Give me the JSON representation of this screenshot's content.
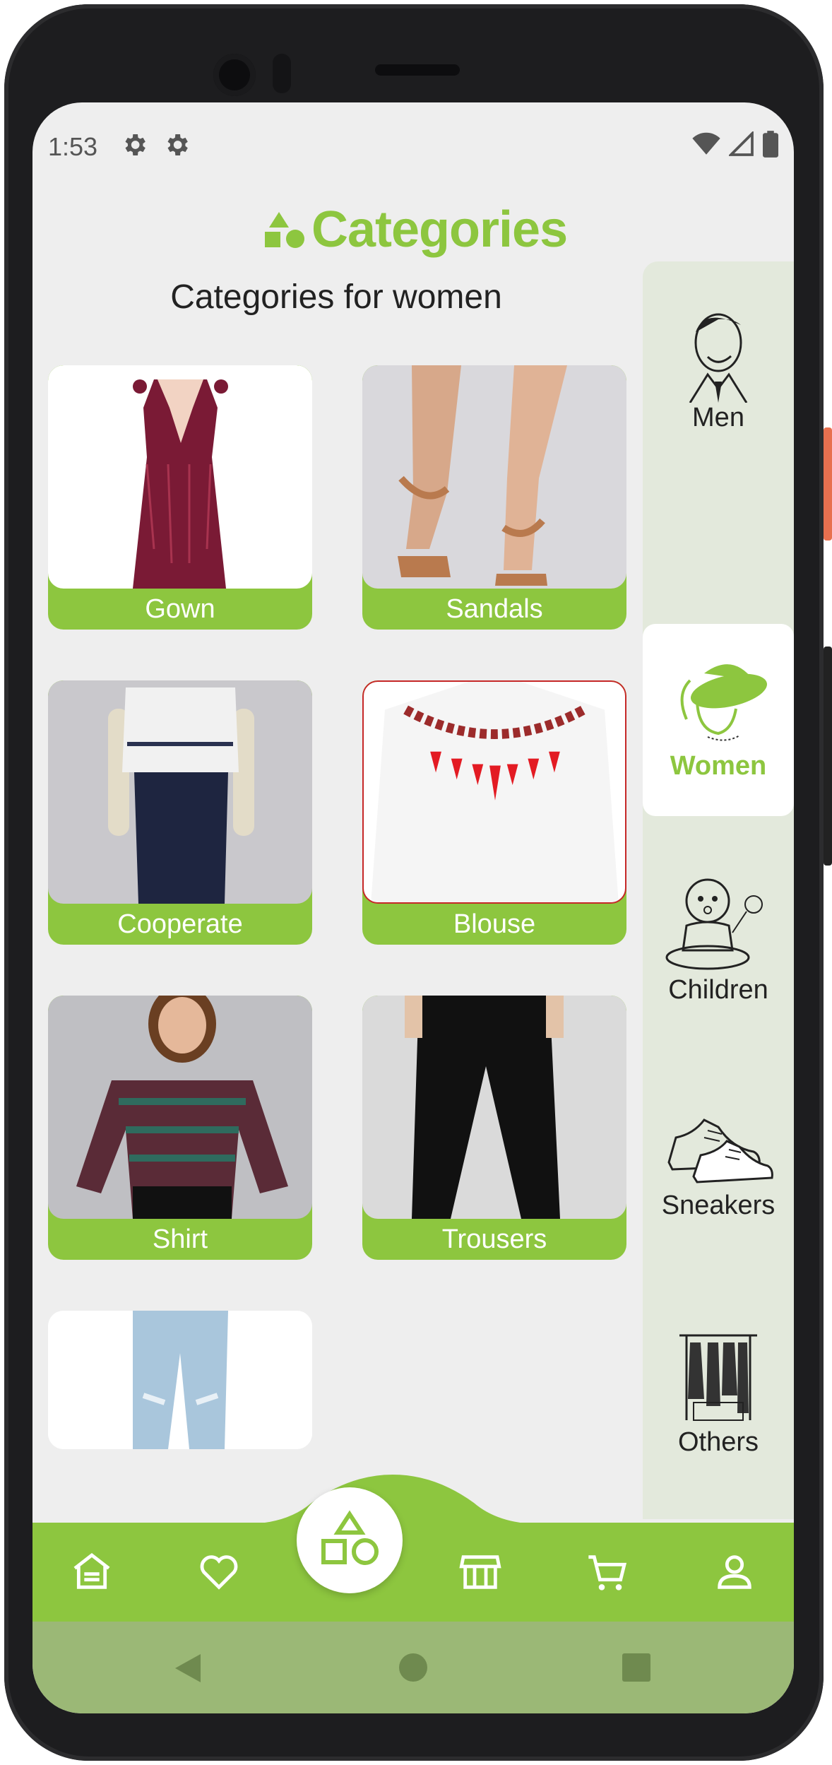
{
  "status_bar": {
    "time": "1:53",
    "icons": [
      "settings-icon",
      "settings-icon",
      "wifi-icon",
      "signal-icon",
      "battery-icon"
    ]
  },
  "header": {
    "title": "Categories",
    "subtitle": "Categories for women"
  },
  "categories": [
    {
      "label": "Gown"
    },
    {
      "label": "Sandals"
    },
    {
      "label": "Cooperate"
    },
    {
      "label": "Blouse"
    },
    {
      "label": "Shirt"
    },
    {
      "label": "Trousers"
    },
    {
      "label": ""
    }
  ],
  "sidebar": {
    "items": [
      {
        "label": "Men",
        "icon": "man-sketch-icon"
      },
      {
        "label": "Women",
        "icon": "woman-hat-icon",
        "active": true
      },
      {
        "label": "Children",
        "icon": "baby-sketch-icon"
      },
      {
        "label": "Sneakers",
        "icon": "sneakers-sketch-icon"
      },
      {
        "label": "Others",
        "icon": "clothes-rack-icon"
      }
    ]
  },
  "bottom_nav": {
    "items": [
      "home-icon",
      "heart-icon",
      "shapes-icon",
      "store-icon",
      "cart-icon",
      "profile-icon"
    ]
  },
  "system_nav": {
    "items": [
      "back-icon",
      "home-circle-icon",
      "recents-icon"
    ]
  },
  "colors": {
    "accent": "#8dc63f",
    "sidebar_bg": "#e3e9dc",
    "screen_bg": "#eeeeee",
    "system_bar": "#9bb876"
  }
}
